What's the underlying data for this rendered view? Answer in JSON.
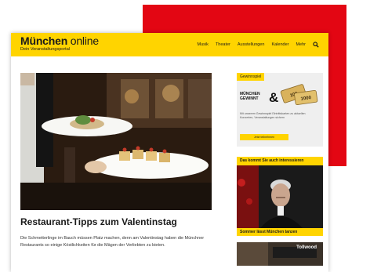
{
  "site": {
    "logo_main": "München",
    "logo_light": " online",
    "logo_sub": "Dein Veranstaltungsportal",
    "nav": [
      "Musik",
      "Theater",
      "Ausstellungen",
      "Kalender",
      "Mehr"
    ],
    "search_icon": "search-icon"
  },
  "colors": {
    "brand_yellow": "#ffd400",
    "accent_red": "#e30613"
  },
  "article": {
    "headline": "Restaurant-Tipps zum Valentinstag",
    "teaser": "Die Schmetterlinge im Bauch müssen Platz machen, denn am Valentinstag haben die Münchner Restaurants so einige Köstlichkeiten für die Mägen der Verliebten zu bieten."
  },
  "sidebar": {
    "ad_label": "Gewinnspiel",
    "ad_brand_line1": "MÜNCHEN",
    "ad_brand_line2": "GEWINNT",
    "ad_amp": "&",
    "ticket_value1": "100",
    "ticket_value2": "1000",
    "ad_small_text": "Mit unserem Gewinnspiel Eintrittskarten zu aktuellen Konzerten, Veranstaltungen sichern",
    "ad_button": "Jetzt teilnehmen",
    "promo_label": "Das kommt Sie auch interessieren",
    "promo_caption": "Sommer lässt München tanzen",
    "promo2_text": "Tollwood"
  }
}
